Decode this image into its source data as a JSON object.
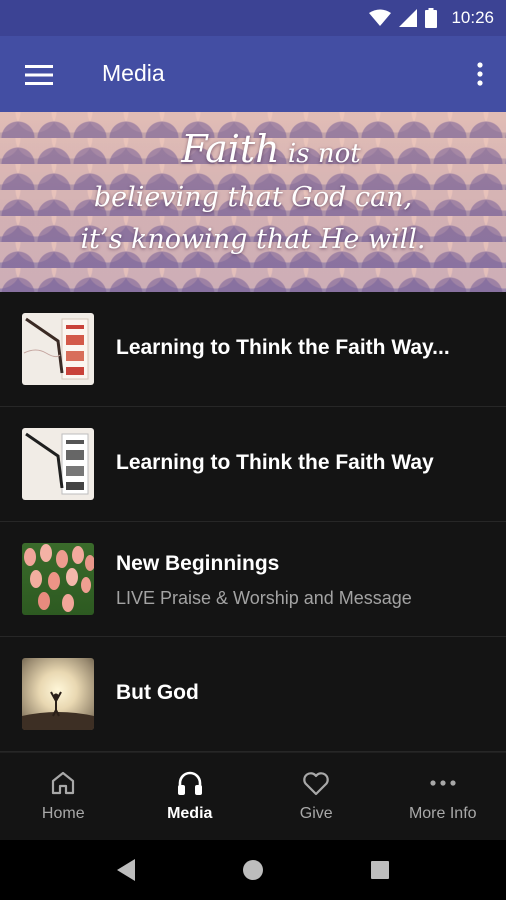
{
  "status_bar": {
    "time": "10:26",
    "icons": [
      "wifi-icon",
      "cell-signal-icon",
      "battery-icon"
    ]
  },
  "app_bar": {
    "title": "Media",
    "menu_icon": "hamburger-menu-icon",
    "overflow_icon": "more-vertical-icon"
  },
  "banner": {
    "line1_big": "Faith",
    "line1_rest": " is not",
    "line2": "believing that God can,",
    "line3": "it’s knowing that He will."
  },
  "media_list": [
    {
      "title": "Learning to Think the Faith Way...",
      "subtitle": ""
    },
    {
      "title": "Learning to Think the Faith Way",
      "subtitle": ""
    },
    {
      "title": "New Beginnings",
      "subtitle": "LIVE Praise & Worship and Message"
    },
    {
      "title": "But God",
      "subtitle": ""
    }
  ],
  "bottom_nav": {
    "items": [
      {
        "label": "Home",
        "icon": "home-icon",
        "active": false
      },
      {
        "label": "Media",
        "icon": "headphones-icon",
        "active": true
      },
      {
        "label": "Give",
        "icon": "heart-icon",
        "active": false
      },
      {
        "label": "More Info",
        "icon": "more-horizontal-icon",
        "active": false
      }
    ]
  },
  "system_nav": [
    "back-icon",
    "home-circle-icon",
    "recents-square-icon"
  ],
  "colors": {
    "status_bar": "#3c4394",
    "app_bar": "#434ea3",
    "background": "#141414",
    "subtitle": "#a3a3a3"
  }
}
